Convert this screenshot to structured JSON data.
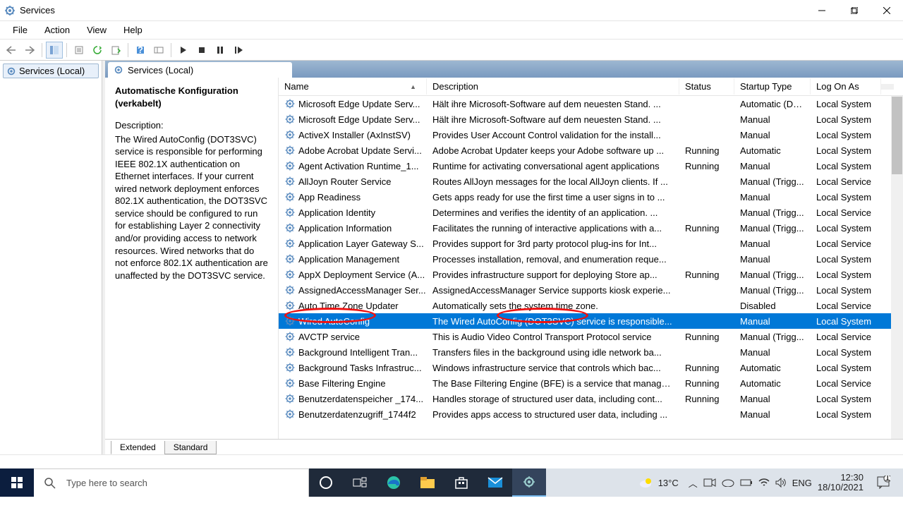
{
  "window": {
    "title": "Services"
  },
  "menu": {
    "file": "File",
    "action": "Action",
    "view": "View",
    "help": "Help"
  },
  "tree": {
    "root": "Services (Local)"
  },
  "panel": {
    "header": "Services (Local)"
  },
  "details": {
    "title": "Automatische Konfiguration (verkabelt)",
    "desc_label": "Description:",
    "desc_text": "The Wired AutoConfig (DOT3SVC) service is responsible for performing IEEE 802.1X authentication on Ethernet interfaces. If your current wired network deployment enforces 802.1X authentication, the DOT3SVC service should be configured to run for establishing Layer 2 connectivity and/or providing access to network resources. Wired networks that do not enforce 802.1X authentication are unaffected by the DOT3SVC service."
  },
  "columns": {
    "name": "Name",
    "desc": "Description",
    "status": "Status",
    "startup": "Startup Type",
    "logon": "Log On As"
  },
  "rows": [
    {
      "name": "Microsoft Edge Update Serv...",
      "desc": "Hält ihre Microsoft-Software auf dem neuesten Stand. ...",
      "status": "",
      "startup": "Automatic (De...",
      "logon": "Local System"
    },
    {
      "name": "Microsoft Edge Update Serv...",
      "desc": "Hält ihre Microsoft-Software auf dem neuesten Stand. ...",
      "status": "",
      "startup": "Manual",
      "logon": "Local System"
    },
    {
      "name": "ActiveX Installer (AxInstSV)",
      "desc": "Provides User Account Control validation for the install...",
      "status": "",
      "startup": "Manual",
      "logon": "Local System"
    },
    {
      "name": "Adobe Acrobat Update Servi...",
      "desc": "Adobe Acrobat Updater keeps your Adobe software up ...",
      "status": "Running",
      "startup": "Automatic",
      "logon": "Local System"
    },
    {
      "name": "Agent Activation Runtime_1...",
      "desc": "Runtime for activating conversational agent applications",
      "status": "Running",
      "startup": "Manual",
      "logon": "Local System"
    },
    {
      "name": "AllJoyn Router Service",
      "desc": "Routes AllJoyn messages for the local AllJoyn clients. If ...",
      "status": "",
      "startup": "Manual (Trigg...",
      "logon": "Local Service"
    },
    {
      "name": "App Readiness",
      "desc": "Gets apps ready for use the first time a user signs in to ...",
      "status": "",
      "startup": "Manual",
      "logon": "Local System"
    },
    {
      "name": "Application Identity",
      "desc": "Determines and verifies the identity of an application. ...",
      "status": "",
      "startup": "Manual (Trigg...",
      "logon": "Local Service"
    },
    {
      "name": "Application Information",
      "desc": "Facilitates the running of interactive applications with a...",
      "status": "Running",
      "startup": "Manual (Trigg...",
      "logon": "Local System"
    },
    {
      "name": "Application Layer Gateway S...",
      "desc": "Provides support for 3rd party protocol plug-ins for Int...",
      "status": "",
      "startup": "Manual",
      "logon": "Local Service"
    },
    {
      "name": "Application Management",
      "desc": "Processes installation, removal, and enumeration reque...",
      "status": "",
      "startup": "Manual",
      "logon": "Local System"
    },
    {
      "name": "AppX Deployment Service (A...",
      "desc": "Provides infrastructure support for deploying Store ap...",
      "status": "Running",
      "startup": "Manual (Trigg...",
      "logon": "Local System"
    },
    {
      "name": "AssignedAccessManager Ser...",
      "desc": "AssignedAccessManager Service supports kiosk experie...",
      "status": "",
      "startup": "Manual (Trigg...",
      "logon": "Local System"
    },
    {
      "name": "Auto Time Zone Updater",
      "desc": "Automatically sets the system time zone.",
      "status": "",
      "startup": "Disabled",
      "logon": "Local Service"
    },
    {
      "name": "Wired AutoConfig",
      "desc": "The Wired AutoConfig (DOT3SVC) service is responsible...",
      "status": "",
      "startup": "Manual",
      "logon": "Local System",
      "selected": true
    },
    {
      "name": "AVCTP service",
      "desc": "This is Audio Video Control Transport Protocol service",
      "status": "Running",
      "startup": "Manual (Trigg...",
      "logon": "Local Service"
    },
    {
      "name": "Background Intelligent Tran...",
      "desc": "Transfers files in the background using idle network ba...",
      "status": "",
      "startup": "Manual",
      "logon": "Local System"
    },
    {
      "name": "Background Tasks Infrastruc...",
      "desc": "Windows infrastructure service that controls which bac...",
      "status": "Running",
      "startup": "Automatic",
      "logon": "Local System"
    },
    {
      "name": "Base Filtering Engine",
      "desc": "The Base Filtering Engine (BFE) is a service that manage...",
      "status": "Running",
      "startup": "Automatic",
      "logon": "Local Service"
    },
    {
      "name": "Benutzerdatenspeicher _174...",
      "desc": "Handles storage of structured user data, including cont...",
      "status": "Running",
      "startup": "Manual",
      "logon": "Local System"
    },
    {
      "name": "Benutzerdatenzugriff_1744f2",
      "desc": "Provides apps access to structured user data, including ...",
      "status": "",
      "startup": "Manual",
      "logon": "Local System"
    }
  ],
  "bottom_tabs": {
    "extended": "Extended",
    "standard": "Standard"
  },
  "taskbar": {
    "search_placeholder": "Type here to search",
    "weather_temp": "13°C",
    "lang": "ENG",
    "time": "12:30",
    "date": "18/10/2021",
    "notif_count": "1"
  }
}
